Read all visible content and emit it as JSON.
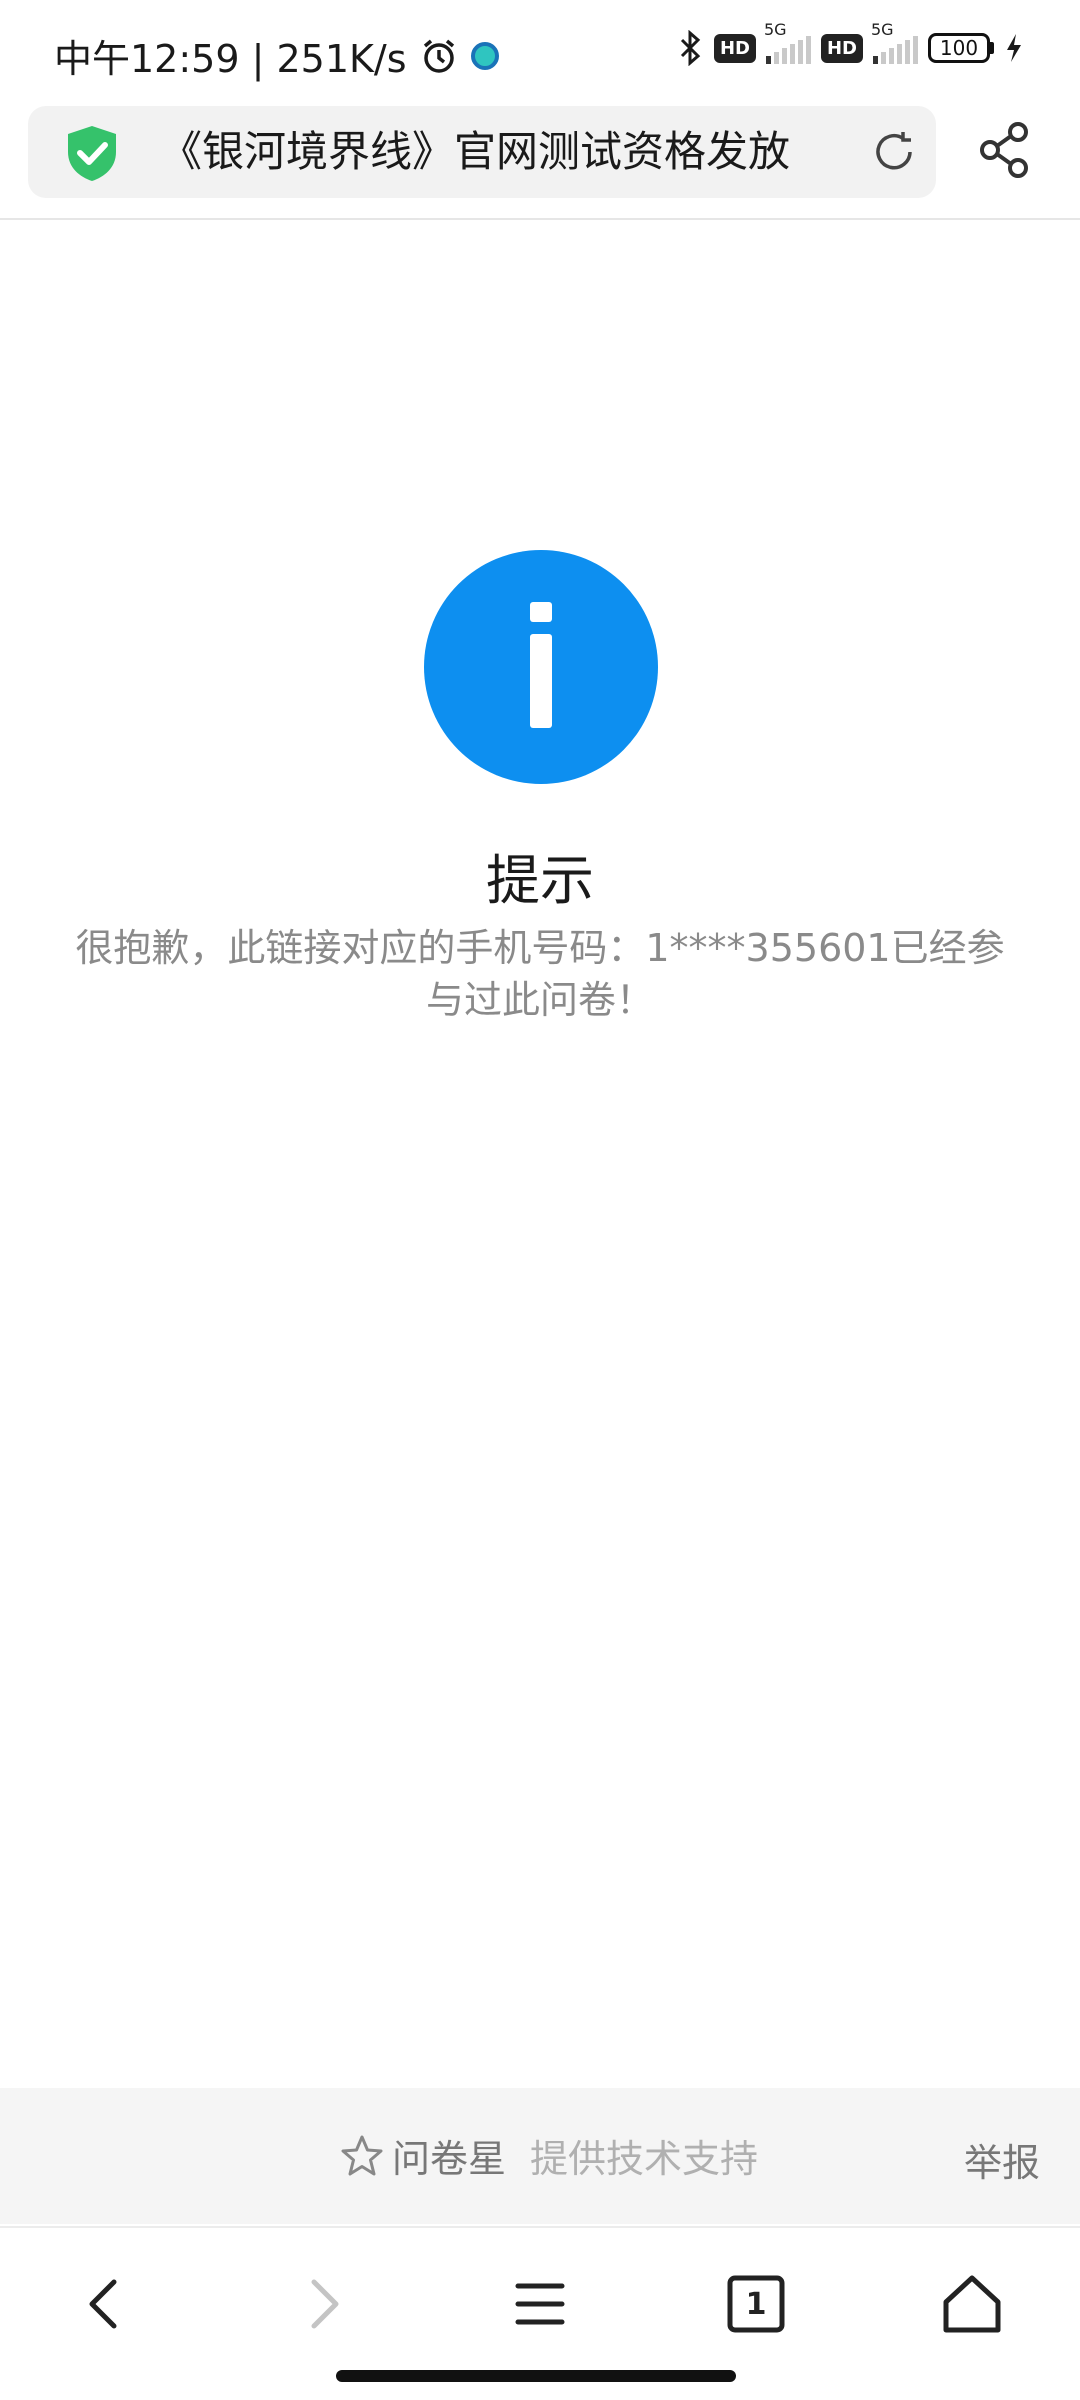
{
  "status_bar": {
    "time_speed": "中午12:59 | 251K/s",
    "hd1": "HD",
    "net1": "5G",
    "hd2": "HD",
    "net2": "5G",
    "battery": "100",
    "icons": [
      "alarm-icon",
      "app-notification-icon",
      "bluetooth-icon",
      "signal-icon",
      "battery-icon",
      "charging-icon"
    ]
  },
  "browser": {
    "page_title": "《银河境界线》官网测试资格发放",
    "icons": [
      "security-shield-icon",
      "refresh-icon",
      "share-icon"
    ],
    "shield_color": "#35c26b"
  },
  "content": {
    "title": "提示",
    "message": "很抱歉，此链接对应的手机号码：1****355601已经参与过此问卷！",
    "icon": "info-icon",
    "icon_color": "#0d8ff0"
  },
  "footer": {
    "brand": "问卷星",
    "support": "提供技术支持",
    "report": "举报"
  },
  "navigation": {
    "tab_count": "1",
    "icons": [
      "back-icon",
      "forward-icon",
      "menu-icon",
      "tabs-icon",
      "home-icon"
    ]
  }
}
